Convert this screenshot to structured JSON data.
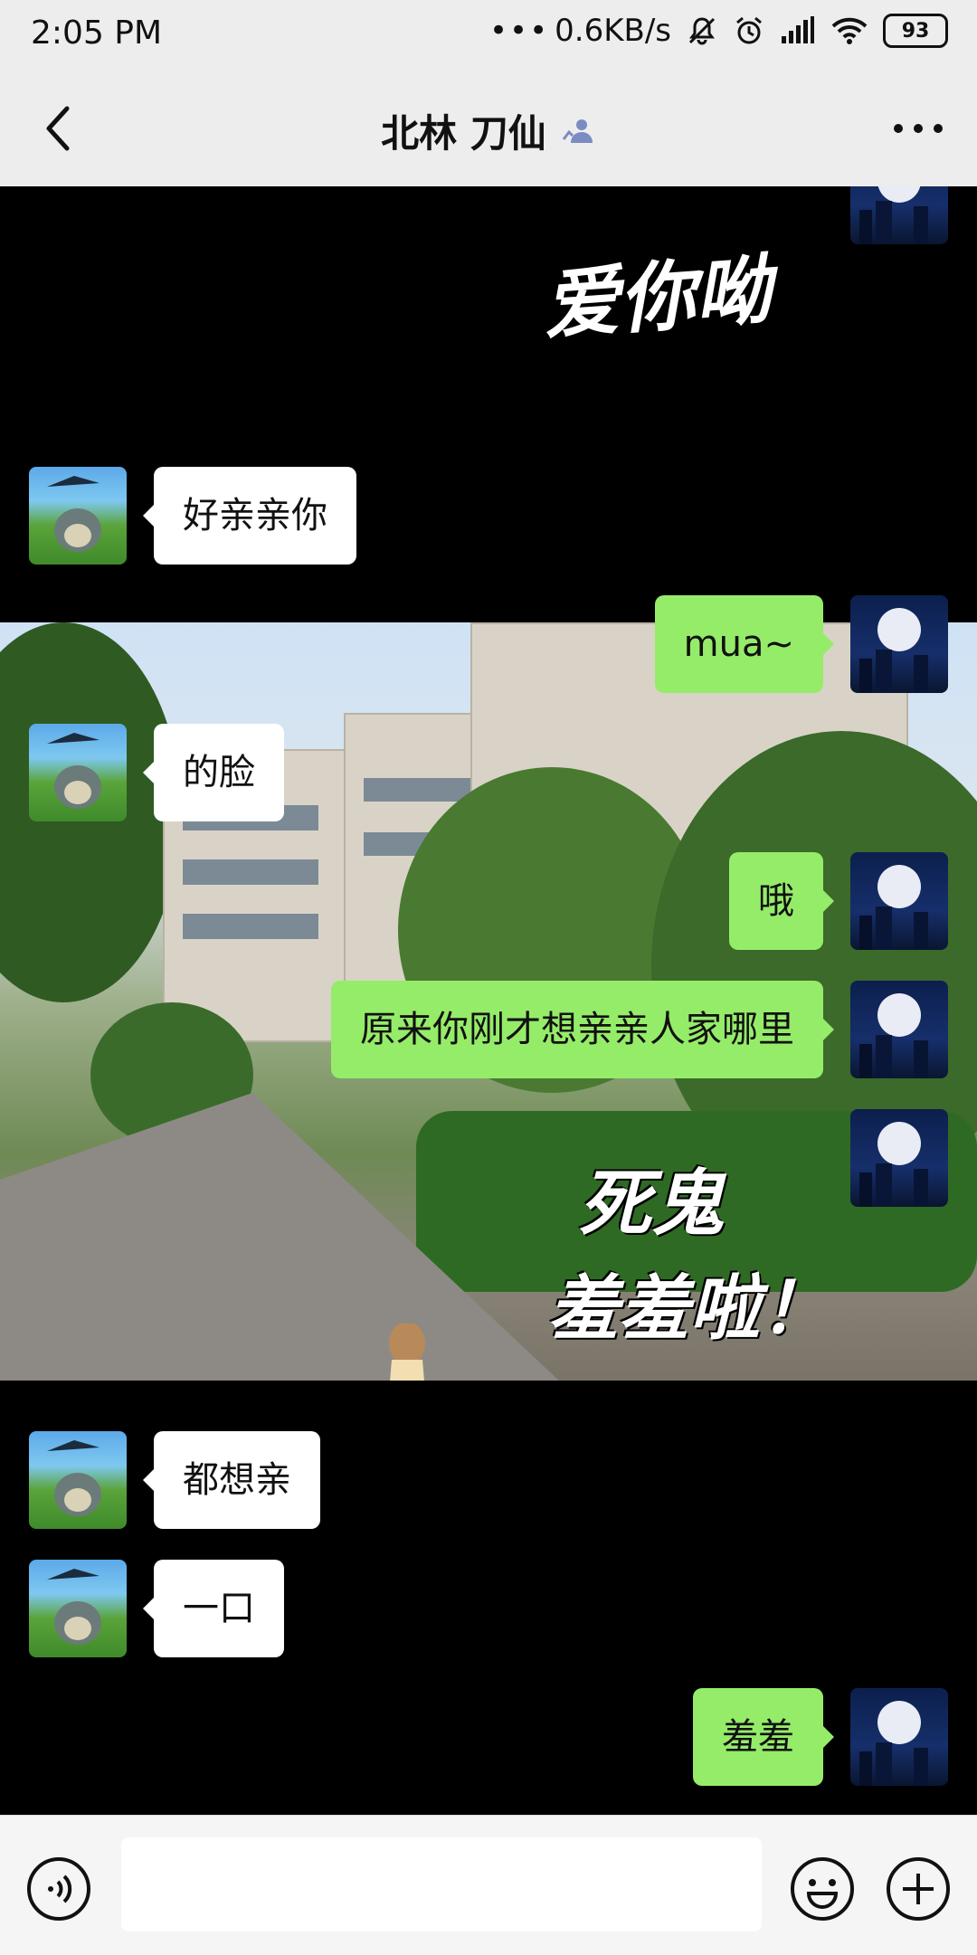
{
  "status_bar": {
    "time": "2:05 PM",
    "network_speed": "0.6KB/s",
    "battery": "93",
    "icons": [
      "more-dots-icon",
      "silent-bell-icon",
      "alarm-icon",
      "signal-icon",
      "wifi-icon",
      "battery-icon"
    ]
  },
  "header": {
    "title": "北林 刀仙",
    "back_icon": "back-chevron-icon",
    "more_icon": "more-dots-icon"
  },
  "background_captions": [
    "爱你呦",
    "死鬼",
    "羞羞啦！"
  ],
  "messages": [
    {
      "side": "left",
      "text": "好亲亲你",
      "avatar": "totoro-avatar"
    },
    {
      "side": "right",
      "text": "mua~",
      "avatar": "moon-avatar"
    },
    {
      "side": "left",
      "text": "的脸",
      "avatar": "totoro-avatar"
    },
    {
      "side": "right",
      "text": "哦",
      "avatar": "moon-avatar"
    },
    {
      "side": "right",
      "text": "原来你刚才想亲亲人家哪里",
      "avatar": "moon-avatar"
    },
    {
      "side": "left",
      "text": "都想亲",
      "avatar": "totoro-avatar"
    },
    {
      "side": "left",
      "text": "一口",
      "avatar": "totoro-avatar"
    },
    {
      "side": "right",
      "text": "羞羞",
      "avatar": "moon-avatar"
    }
  ],
  "input_bar": {
    "placeholder": "",
    "voice_icon": "voice-icon",
    "emoji_icon": "emoji-icon",
    "plus_icon": "plus-icon"
  }
}
